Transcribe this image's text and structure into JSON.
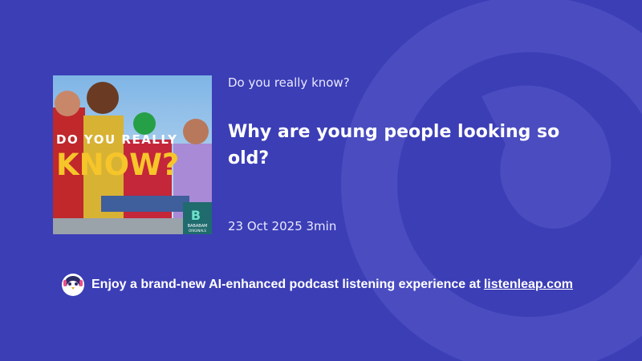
{
  "cover": {
    "line1": "DO YOU REALLY",
    "line2": "KNOW?",
    "brand": "BABABAM",
    "brand_sub": "ORIGINALS"
  },
  "show_title": "Do you really know?",
  "episode_title": "Why are young people looking so old?",
  "meta": {
    "date": "23 Oct 2025",
    "duration": "3min"
  },
  "footer": {
    "promo_text": "Enjoy a brand-new AI-enhanced podcast listening experience at",
    "link_text": "listenleap.com",
    "mascot_icon": "penguin-mascot-icon"
  },
  "colors": {
    "background": "#3c3eb6",
    "cover_yellow": "#f6c52a",
    "brand_teal": "#1f6b6e"
  }
}
